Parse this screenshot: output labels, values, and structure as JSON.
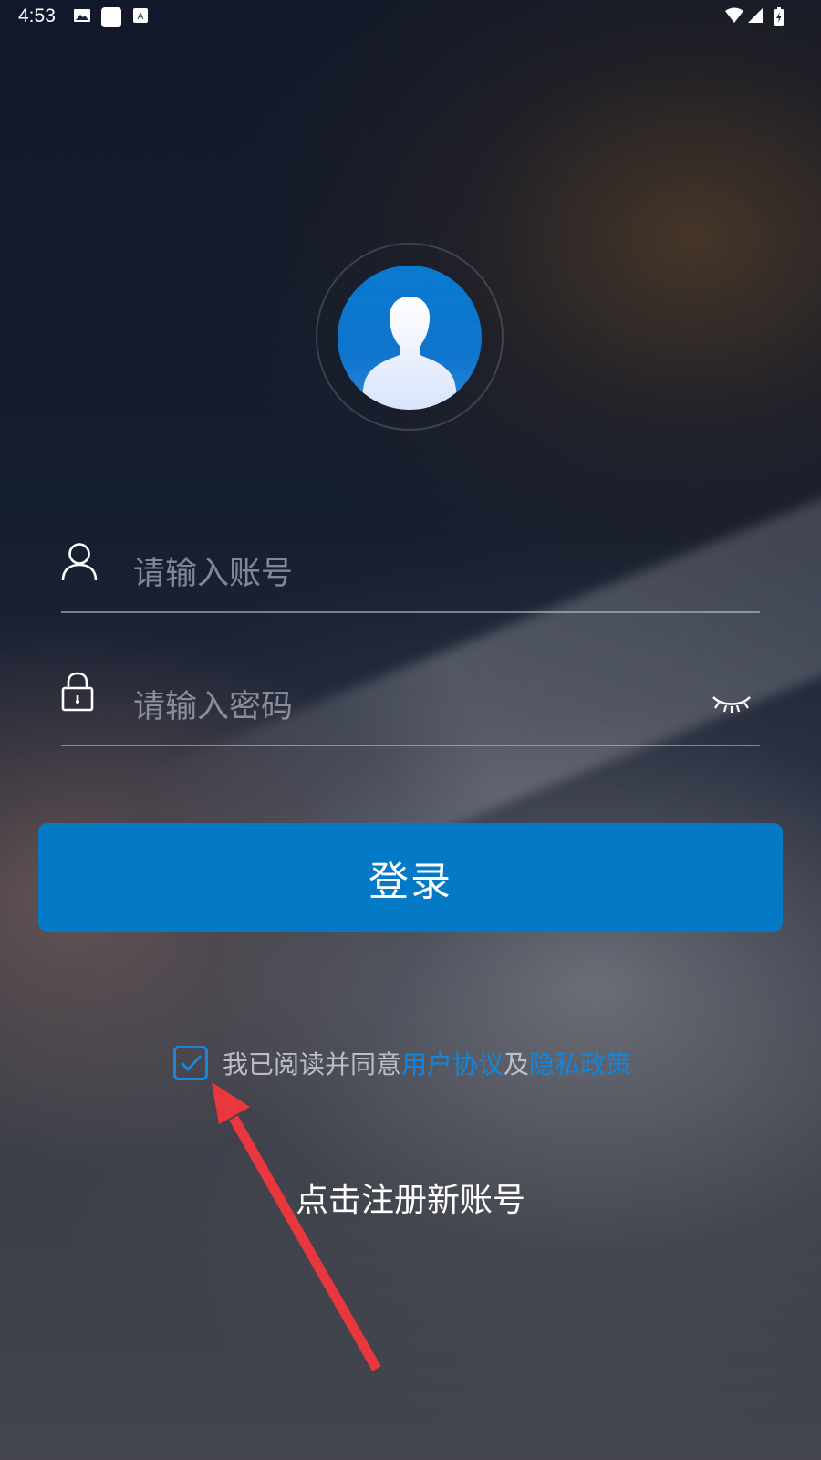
{
  "status_bar": {
    "time": "4:53"
  },
  "login_form": {
    "account_placeholder": "请输入账号",
    "password_placeholder": "请输入密码",
    "login_label": "登录"
  },
  "agreement": {
    "checked": true,
    "prefix": "我已阅读并同意",
    "user_agreement": "用户协议",
    "conjunction": "及",
    "privacy_policy": "隐私政策"
  },
  "annotation": {
    "hint": "点击注册新账号",
    "arrow_color": "#e8383d"
  },
  "colors": {
    "accent": "#0479c6",
    "link": "#1286dc"
  }
}
